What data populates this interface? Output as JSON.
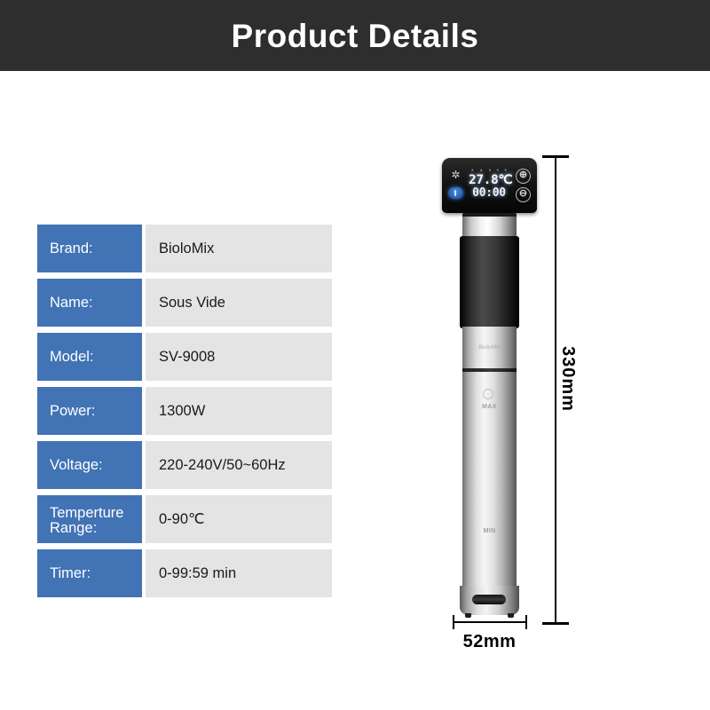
{
  "header": {
    "title": "Product Details",
    "background": "#2e2e2e",
    "text_color": "#ffffff"
  },
  "colors": {
    "label_blue": "#4173b5",
    "value_grey": "#e4e4e4",
    "header_dark": "#2e2e2e"
  },
  "spec_table": {
    "rows": [
      {
        "label": "Brand:",
        "value": "BioloMix"
      },
      {
        "label": "Name:",
        "value": "Sous Vide"
      },
      {
        "label": "Model:",
        "value": "SV-9008"
      },
      {
        "label": "Power:",
        "value": "1300W"
      },
      {
        "label": "Voltage:",
        "value": "220-240V/50~60Hz"
      },
      {
        "label": "Temperture Range:",
        "value": "0-90℃"
      },
      {
        "label": "Timer:",
        "value": "0-99:59 min"
      }
    ]
  },
  "product": {
    "control_panel": {
      "gear_icon": "gear-icon",
      "power_icon": "power-button-icon",
      "plus_label": "⊕",
      "minus_label": "⊖",
      "display_temperature": "27.8℃",
      "display_timer": "00:00",
      "status_indicators": [
        "•",
        "•",
        "•",
        "•",
        "•"
      ]
    },
    "body_markings": {
      "max": "MAX",
      "min": "MIN",
      "brand_emboss": "BioloMix"
    }
  },
  "dimensions": {
    "height_label": "330mm",
    "width_label": "52mm"
  }
}
